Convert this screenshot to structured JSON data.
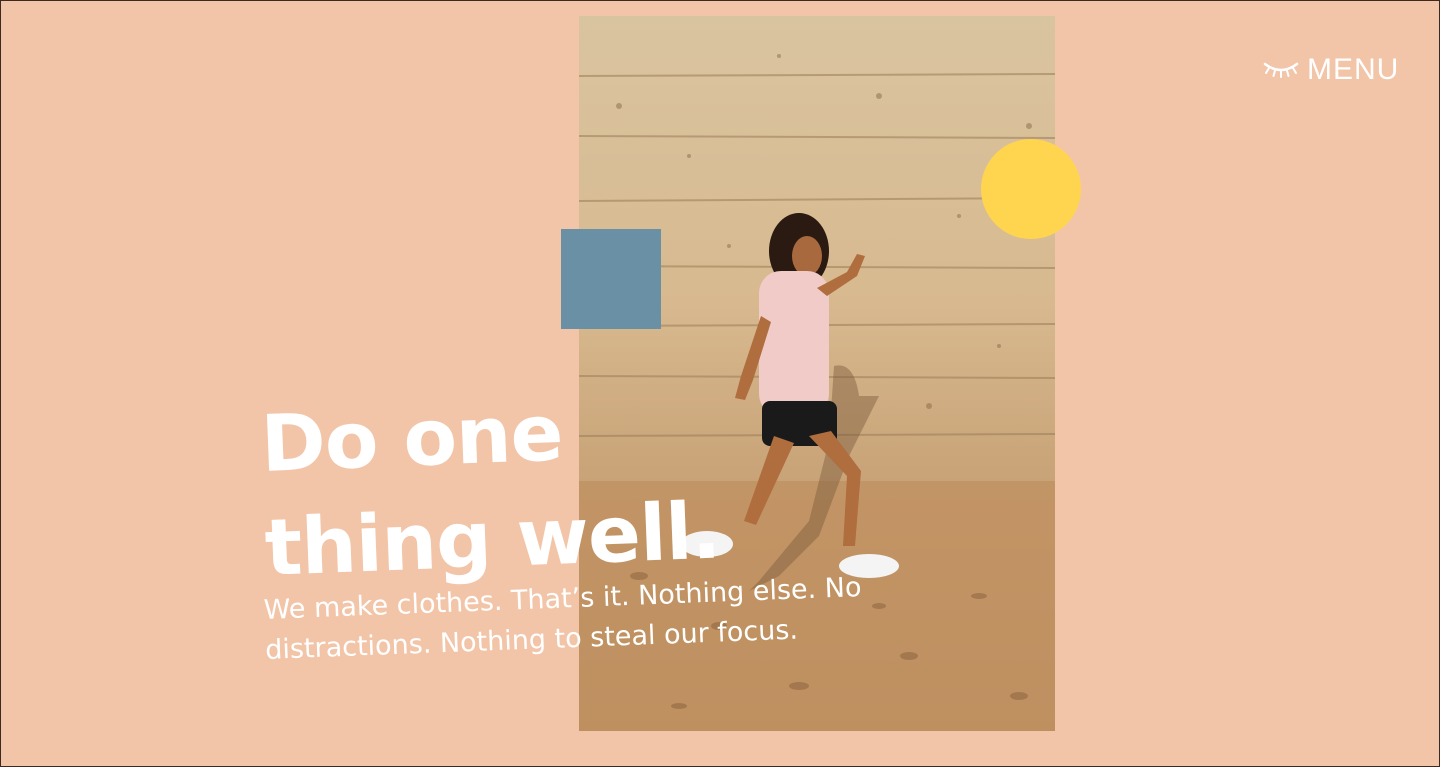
{
  "nav": {
    "menu_label": "MENU",
    "menu_icon": "closed-eye-icon"
  },
  "hero": {
    "headline": "Do one thing well.",
    "subtext": "We make clothes. That’s it. Nothing else. No distractions. Nothing to steal our focus.",
    "image": "woman-walking-photo"
  },
  "colors": {
    "background": "#f2c5a8",
    "square": "#6a90a6",
    "circle": "#ffd54f",
    "text": "#ffffff"
  }
}
